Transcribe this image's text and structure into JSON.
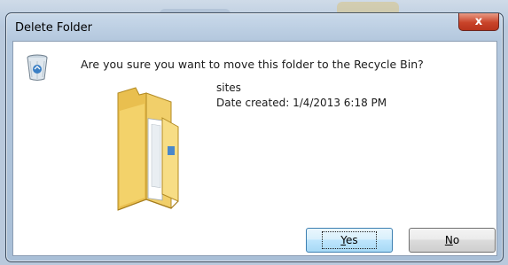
{
  "dialog": {
    "title": "Delete Folder",
    "close_label": "x",
    "question": "Are you sure you want to move this folder to the Recycle Bin?",
    "item_name": "sites",
    "date_created": "Date created: 1/4/2013 6:18 PM",
    "buttons": {
      "yes_mnemonic": "Y",
      "yes_rest": "es",
      "no_mnemonic": "N",
      "no_rest": "o"
    }
  },
  "icons": {
    "bin": "recycle-bin-icon",
    "folder": "folder-icon"
  },
  "colors": {
    "close_button": "#c9442a",
    "default_button_border": "#3c7fb1",
    "folder_yellow": "#f5d56e"
  }
}
